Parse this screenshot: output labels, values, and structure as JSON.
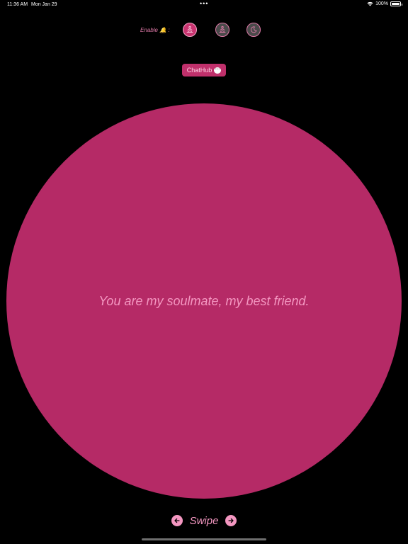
{
  "status_bar": {
    "time": "11:36 AM",
    "date": "Mon Jan 29",
    "dots": "•••",
    "battery_percent": "100%",
    "battery_level": 1.0
  },
  "enable_row": {
    "label": "Enable 🔔 :",
    "modes": [
      {
        "icon": "meditation-icon",
        "state": "active"
      },
      {
        "icon": "meditation-outline-icon",
        "state": "inactive"
      },
      {
        "icon": "moon-icon",
        "state": "inactive"
      }
    ]
  },
  "chathub": {
    "label": "ChatHub",
    "icon": "speech-bubble-icon"
  },
  "quote": {
    "text": "You are my soulmate, my best friend."
  },
  "swipe": {
    "label": "Swipe",
    "prev_icon": "arrow-left-icon",
    "next_icon": "arrow-right-icon"
  },
  "colors": {
    "background": "#000000",
    "circle": "#b52a66",
    "accent_pink": "#f497c1",
    "button_pink": "#c0306b"
  }
}
